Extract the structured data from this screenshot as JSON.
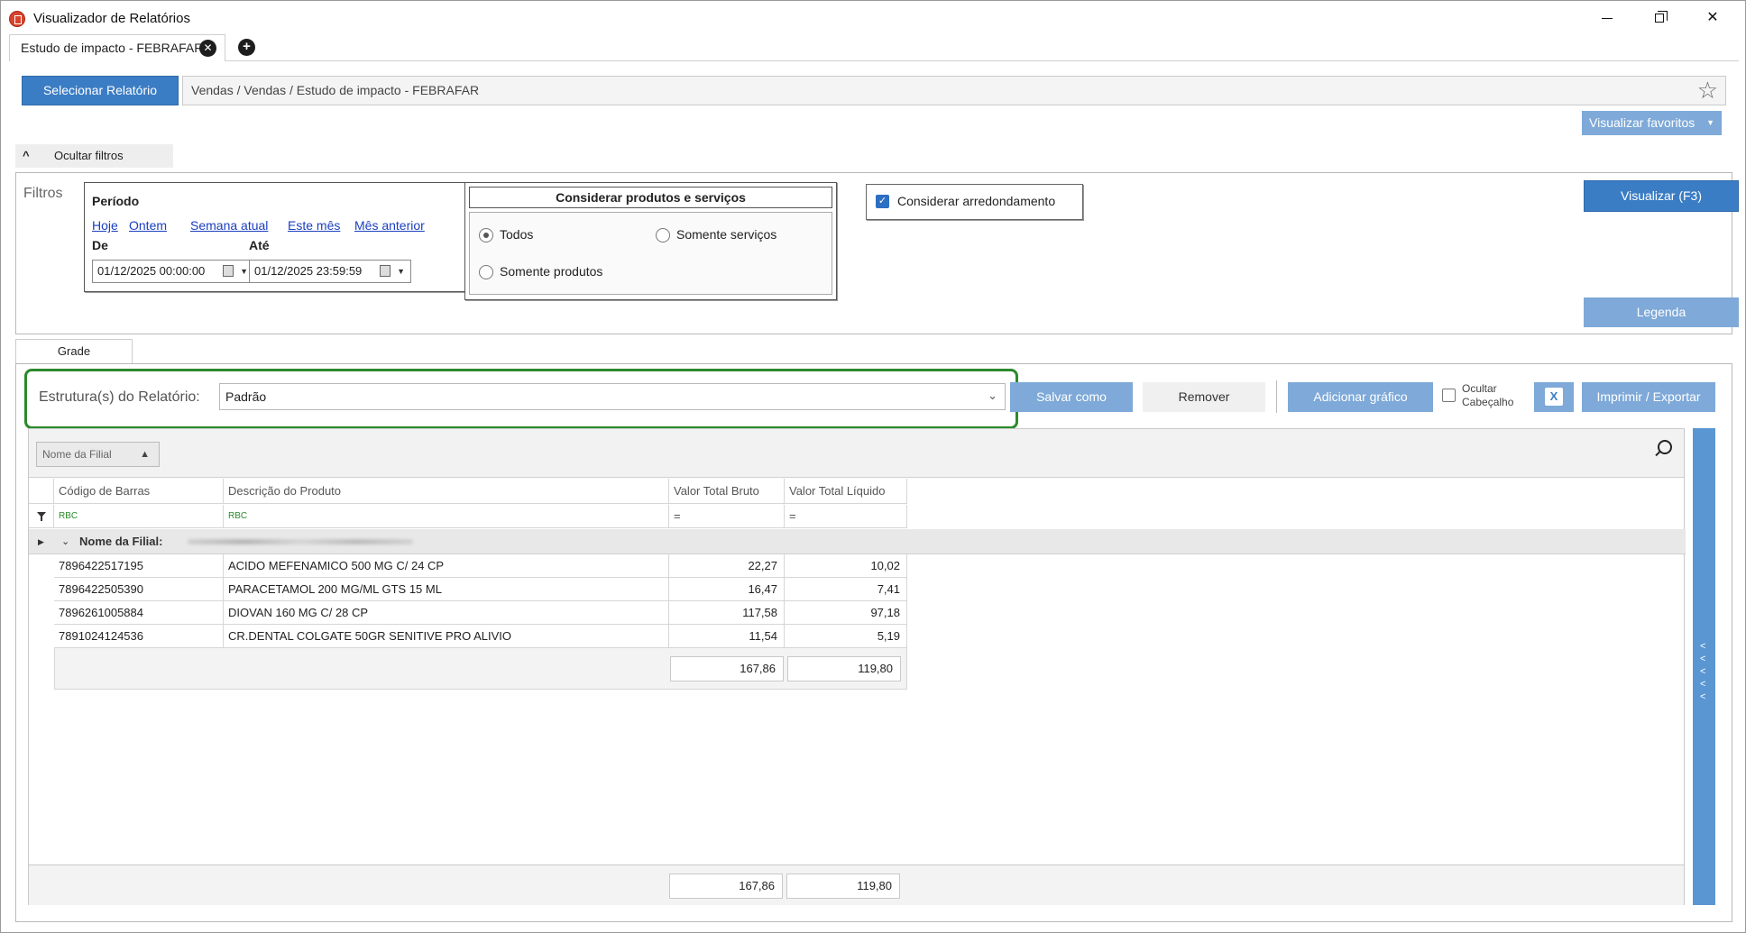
{
  "window": {
    "title": "Visualizador de Relatórios",
    "minimize": "—",
    "maximize": "",
    "close": "✕"
  },
  "tabs": [
    {
      "label": "Estudo de impacto - FEBRAFAR"
    }
  ],
  "report": {
    "select_button": "Selecionar Relatório",
    "path": "Vendas / Vendas / Estudo de impacto - FEBRAFAR",
    "favorites_button": "Visualizar favoritos"
  },
  "filters": {
    "toggle_label": "Ocultar filtros",
    "section_label": "Filtros",
    "period": {
      "title": "Período",
      "shortcuts": [
        "Hoje",
        "Ontem",
        "Semana atual",
        "Este mês",
        "Mês anterior"
      ],
      "from_label": "De",
      "to_label": "Até",
      "from_value": "01/12/2025 00:00:00",
      "to_value": "01/12/2025 23:59:59"
    },
    "products": {
      "title": "Considerar produtos e serviços",
      "options": [
        "Todos",
        "Somente serviços",
        "Somente produtos"
      ],
      "selected": "Todos"
    },
    "rounding": {
      "label": "Considerar arredondamento",
      "checked": true
    },
    "view_button": "Visualizar (F3)",
    "legend_button": "Legenda"
  },
  "grid_tab": "Grade",
  "structure": {
    "label": "Estrutura(s) do Relatório:",
    "value": "Padrão",
    "save_as": "Salvar como",
    "remove": "Remover",
    "add_chart": "Adicionar gráfico",
    "hide_header_line1": "Ocultar",
    "hide_header_line2": "Cabeçalho",
    "print_export": "Imprimir / Exportar"
  },
  "grid": {
    "group_chip": "Nome da Filial",
    "columns": [
      "Código de Barras",
      "Descrição do Produto",
      "Valor Total Bruto",
      "Valor Total Líquido"
    ],
    "filter_row": [
      "RBC",
      "RBC",
      "=",
      "="
    ],
    "group_label": "Nome da Filial:",
    "rows": [
      {
        "barcode": "7896422517195",
        "description": "ACIDO MEFENAMICO 500 MG C/ 24 CP",
        "gross": "22,27",
        "net": "10,02"
      },
      {
        "barcode": "7896422505390",
        "description": "PARACETAMOL 200 MG/ML GTS 15 ML",
        "gross": "16,47",
        "net": "7,41"
      },
      {
        "barcode": "7896261005884",
        "description": "DIOVAN 160 MG C/ 28 CP",
        "gross": "117,58",
        "net": "97,18"
      },
      {
        "barcode": "7891024124536",
        "description": "CR.DENTAL COLGATE 50GR SENITIVE PRO ALIVIO",
        "gross": "11,54",
        "net": "5,19"
      }
    ],
    "group_total": {
      "gross": "167,86",
      "net": "119,80"
    },
    "grand_total": {
      "gross": "167,86",
      "net": "119,80"
    }
  },
  "icons": {
    "favorite": "star-icon",
    "search": "search-icon",
    "filter": "filter-icon",
    "excel": "excel-icon",
    "calendar": "calendar-icon"
  },
  "colors": {
    "primary_button": "#3b7dc4",
    "light_button": "#7ea9d8",
    "highlight_border": "#2b8a2b",
    "link": "#1a3fbf"
  }
}
